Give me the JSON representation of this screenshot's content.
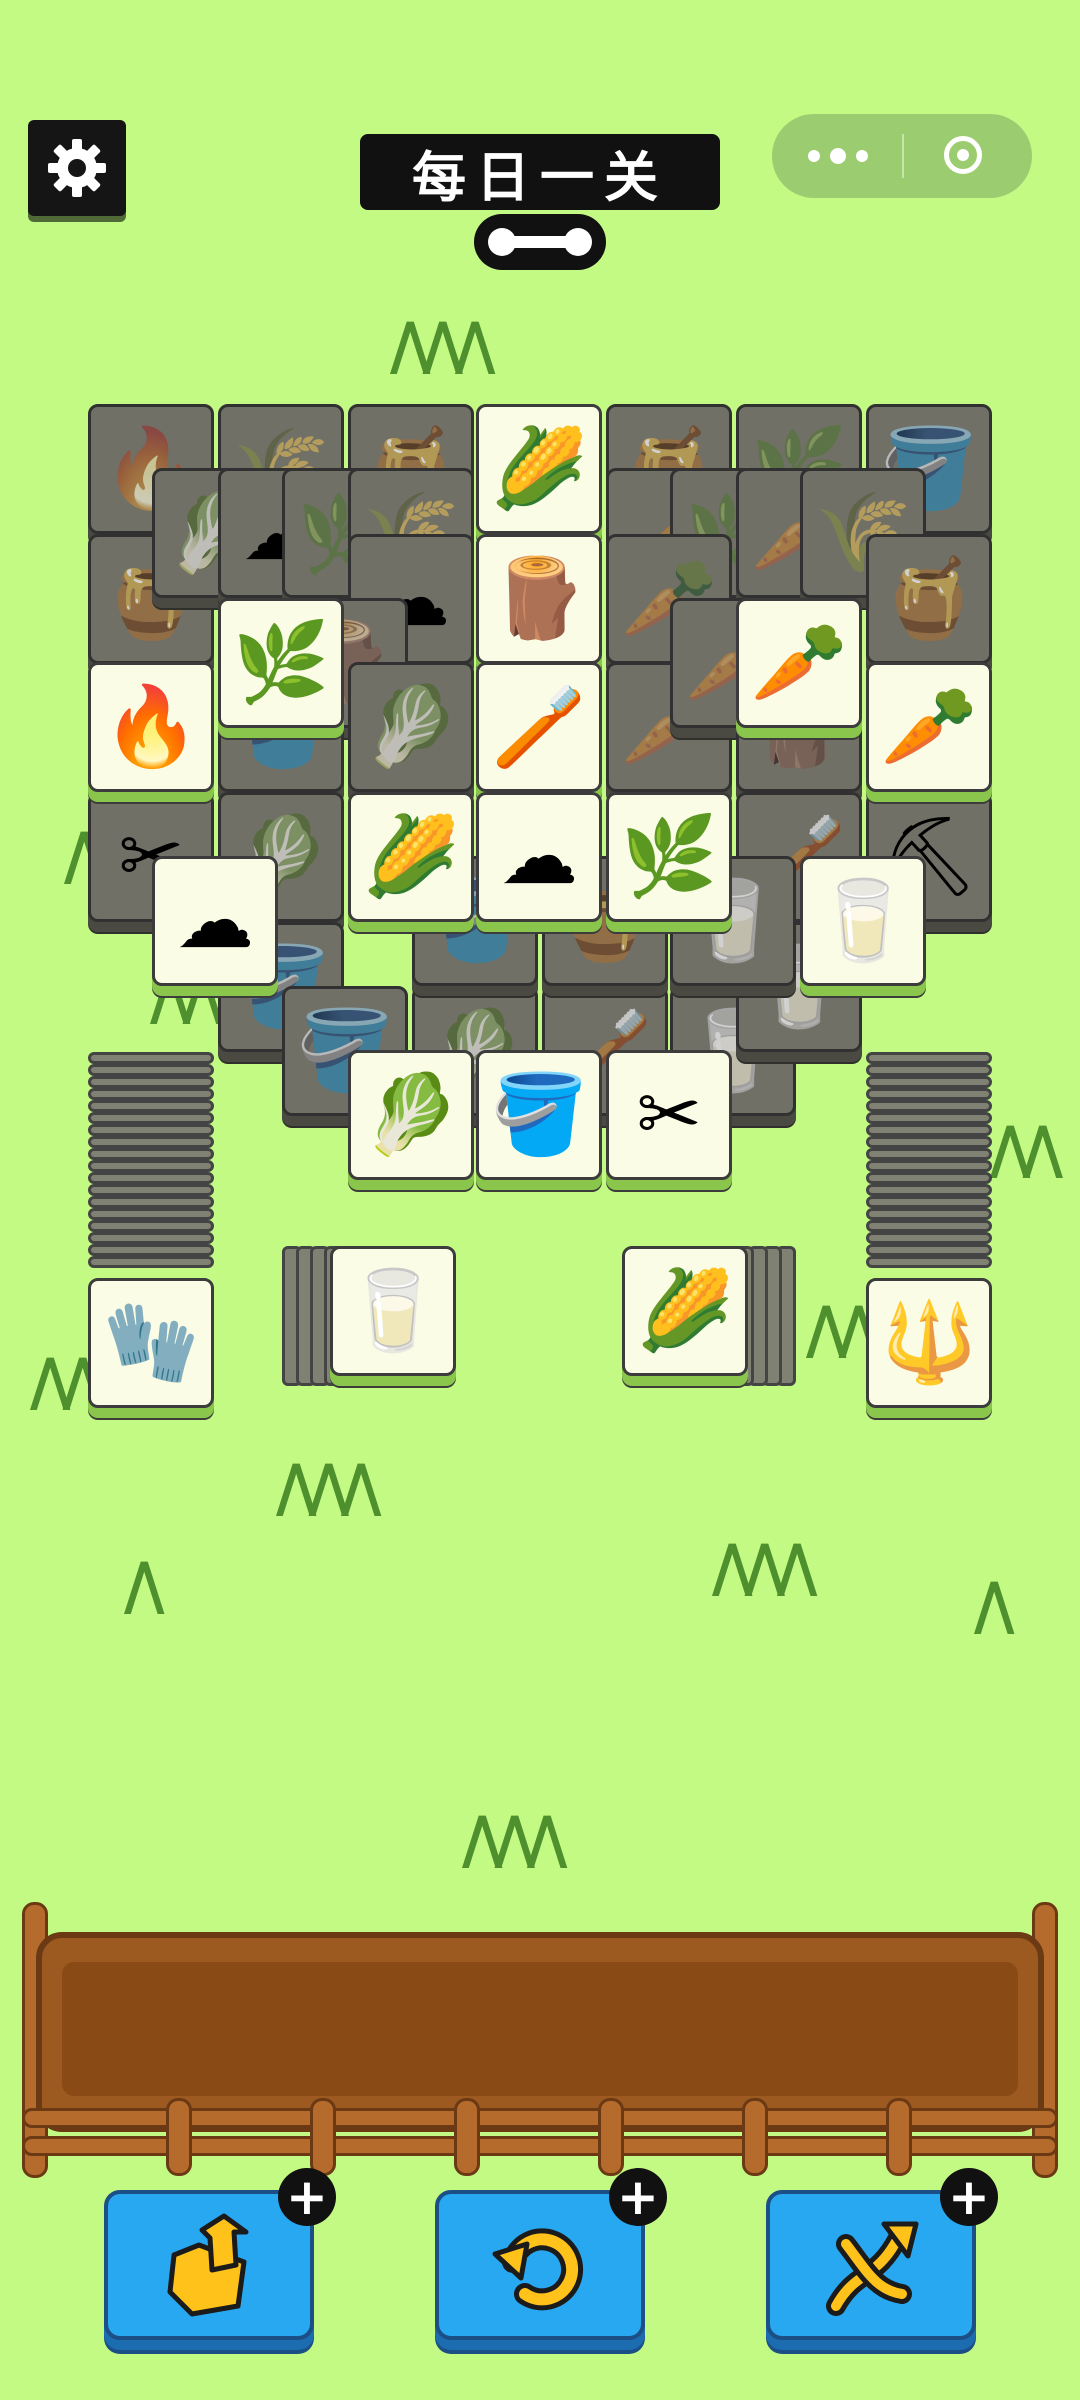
{
  "header": {
    "title": "每日一关",
    "settings_icon": "gear-icon",
    "menu_icon": "more-dots-icon",
    "close_icon": "target-circle-icon",
    "progress_icon": "progress-bar-icon"
  },
  "icons": {
    "corn": "🌽",
    "carrot": "🥕",
    "fire": "🔥",
    "bucket": "🪣",
    "grass": "🌿",
    "stump": "🪵",
    "brush": "🪥",
    "cotton": "☁",
    "cabbage": "🥬",
    "shears": "✂",
    "milk": "🥛",
    "glove": "🧤",
    "fork": "🔱",
    "shovel": "⛏",
    "wheat": "🌾",
    "hive": "🍯"
  },
  "board": {
    "active_tiles": [
      "corn",
      "stump",
      "grass",
      "fire",
      "brush",
      "carrot",
      "carrot",
      "corn",
      "cotton",
      "grass",
      "cotton",
      "milk",
      "cabbage",
      "bucket",
      "shears"
    ],
    "side_stacks": [
      "glove",
      "milk",
      "corn",
      "fork"
    ]
  },
  "tools": [
    {
      "name": "move-out",
      "icon": "box-out-icon",
      "badge": "+"
    },
    {
      "name": "undo",
      "icon": "undo-arrow-icon",
      "badge": "+"
    },
    {
      "name": "shuffle",
      "icon": "shuffle-icon",
      "badge": "+"
    }
  ],
  "colors": {
    "background": "#c3fa84",
    "tile_face": "#fafce5",
    "tile_shadow": "#89c64b",
    "tray": "#9d5a20",
    "tool_button": "#27a8f0"
  }
}
